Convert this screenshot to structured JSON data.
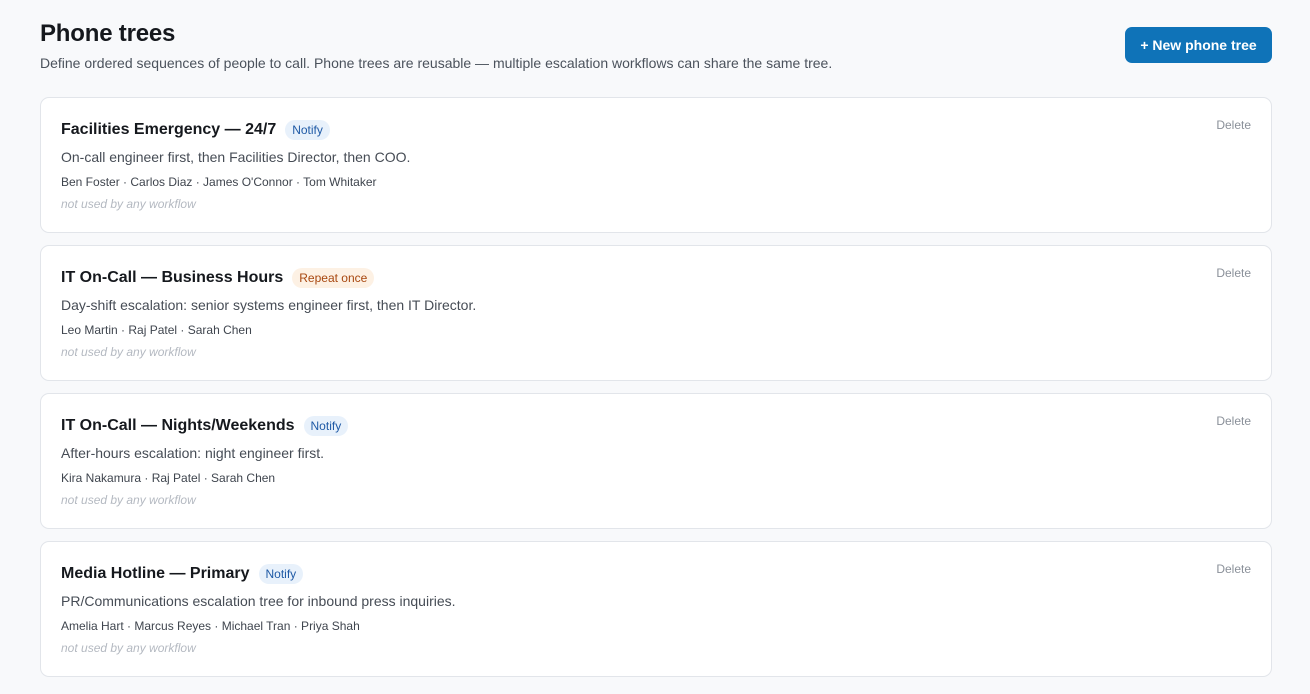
{
  "header": {
    "title": "Phone trees",
    "subtitle": "Define ordered sequences of people to call. Phone trees are reusable — multiple escalation workflows can share the same tree.",
    "new_button_label": "+ New phone tree"
  },
  "trees": [
    {
      "name": "Facilities Emergency — 24/7",
      "badge": "Notify",
      "badge_type": "notify",
      "description": "On-call engineer first, then Facilities Director, then COO.",
      "members": "Ben Foster · Carlos Diaz · James O'Connor · Tom Whitaker",
      "usage": "not used by any workflow",
      "delete_label": "Delete"
    },
    {
      "name": "IT On-Call — Business Hours",
      "badge": "Repeat once",
      "badge_type": "repeat",
      "description": "Day-shift escalation: senior systems engineer first, then IT Director.",
      "members": "Leo Martin · Raj Patel · Sarah Chen",
      "usage": "not used by any workflow",
      "delete_label": "Delete"
    },
    {
      "name": "IT On-Call — Nights/Weekends",
      "badge": "Notify",
      "badge_type": "notify",
      "description": "After-hours escalation: night engineer first.",
      "members": "Kira Nakamura · Raj Patel · Sarah Chen",
      "usage": "not used by any workflow",
      "delete_label": "Delete"
    },
    {
      "name": "Media Hotline — Primary",
      "badge": "Notify",
      "badge_type": "notify",
      "description": "PR/Communications escalation tree for inbound press inquiries.",
      "members": "Amelia Hart · Marcus Reyes · Michael Tran · Priya Shah",
      "usage": "not used by any workflow",
      "delete_label": "Delete"
    }
  ],
  "colors": {
    "primary": "#0f73b8",
    "notify_badge_bg": "#e8f1fb",
    "notify_badge_text": "#1f5aa6",
    "repeat_badge_bg": "#fdf1e4",
    "repeat_badge_text": "#a8470f"
  }
}
